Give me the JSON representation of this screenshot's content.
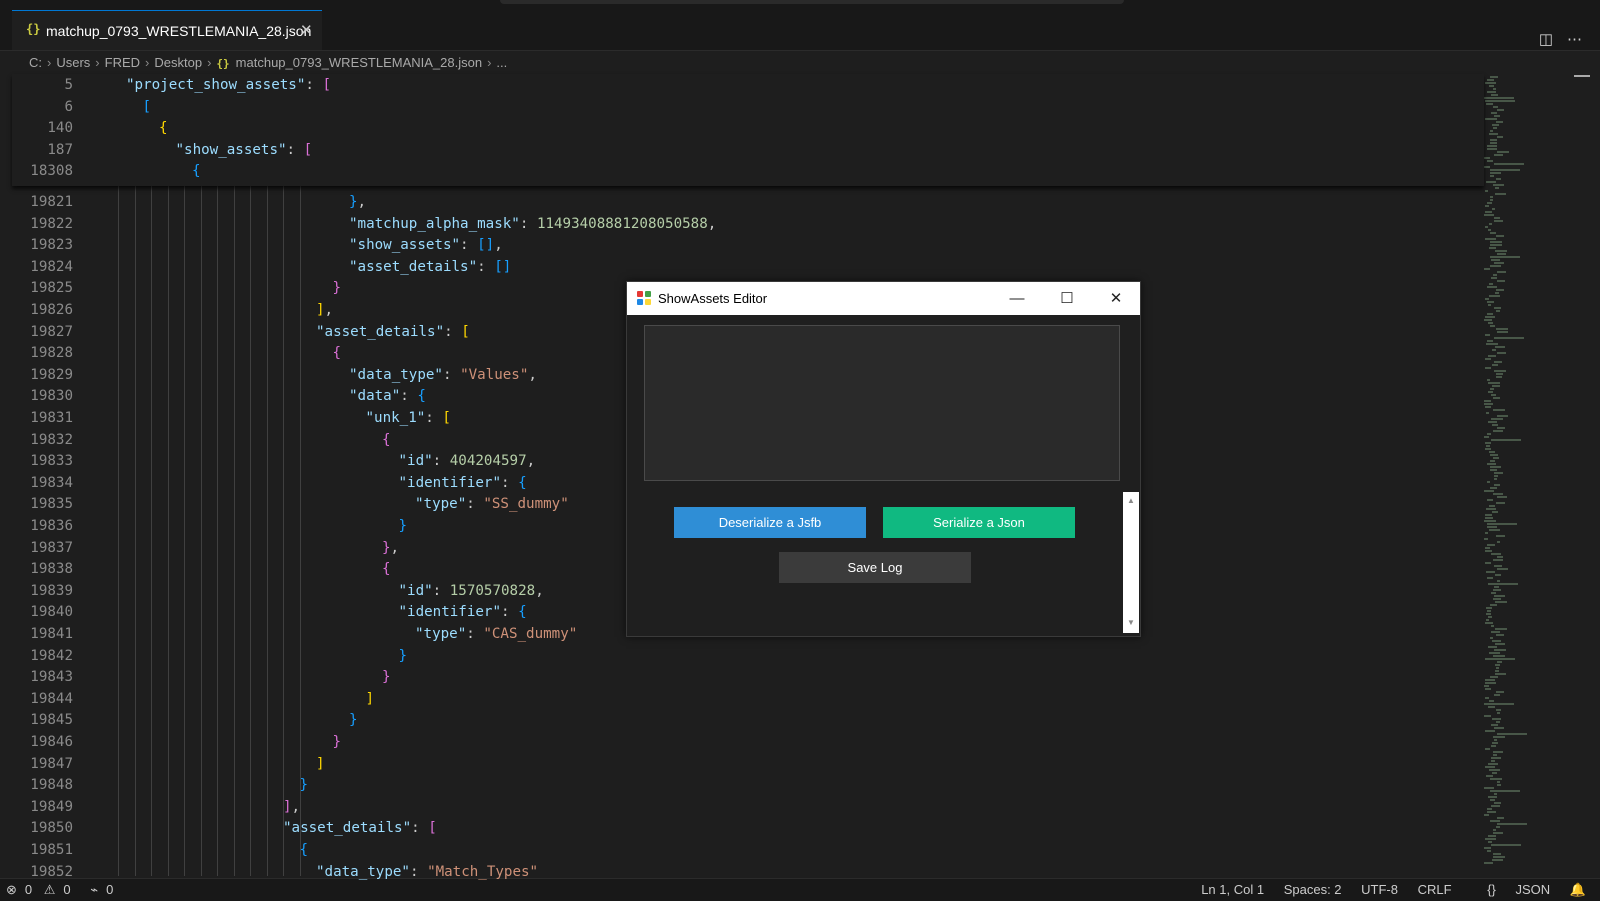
{
  "tab": {
    "label": "matchup_0793_WRESTLEMANIA_28.json",
    "icon": "{}"
  },
  "breadcrumb": [
    "C:",
    "Users",
    "FRED",
    "Desktop",
    "matchup_0793_WRESTLEMANIA_28.json",
    "..."
  ],
  "sticky_lines": [
    {
      "no": "5",
      "indent": 1,
      "parts": [
        [
          "k",
          "\"project_show_assets\""
        ],
        [
          "p",
          ": "
        ],
        [
          "b2",
          "["
        ]
      ]
    },
    {
      "no": "6",
      "indent": 2,
      "parts": [
        [
          "b3",
          "["
        ]
      ]
    },
    {
      "no": "140",
      "indent": 3,
      "parts": [
        [
          "b1",
          "{"
        ]
      ]
    },
    {
      "no": "187",
      "indent": 4,
      "parts": [
        [
          "k",
          "\"show_assets\""
        ],
        [
          "p",
          ": "
        ],
        [
          "b2",
          "["
        ]
      ]
    },
    {
      "no": "18308",
      "indent": 5,
      "parts": [
        [
          "b3",
          "{"
        ]
      ]
    }
  ],
  "lines": [
    {
      "no": "19821",
      "indent": 14,
      "parts": [
        [
          "b3",
          "}"
        ],
        [
          "p",
          ","
        ]
      ]
    },
    {
      "no": "19822",
      "indent": 14,
      "parts": [
        [
          "k",
          "\"matchup_alpha_mask\""
        ],
        [
          "p",
          ": "
        ],
        [
          "n",
          "11493408881208050588"
        ],
        [
          "p",
          ","
        ]
      ]
    },
    {
      "no": "19823",
      "indent": 14,
      "parts": [
        [
          "k",
          "\"show_assets\""
        ],
        [
          "p",
          ": "
        ],
        [
          "b3",
          "[]"
        ],
        [
          "p",
          ","
        ]
      ]
    },
    {
      "no": "19824",
      "indent": 14,
      "parts": [
        [
          "k",
          "\"asset_details\""
        ],
        [
          "p",
          ": "
        ],
        [
          "b3",
          "[]"
        ]
      ]
    },
    {
      "no": "19825",
      "indent": 13,
      "parts": [
        [
          "b2",
          "}"
        ]
      ]
    },
    {
      "no": "19826",
      "indent": 12,
      "parts": [
        [
          "b1",
          "]"
        ],
        [
          "p",
          ","
        ]
      ]
    },
    {
      "no": "19827",
      "indent": 12,
      "parts": [
        [
          "k",
          "\"asset_details\""
        ],
        [
          "p",
          ": "
        ],
        [
          "b1",
          "["
        ]
      ]
    },
    {
      "no": "19828",
      "indent": 13,
      "parts": [
        [
          "b2",
          "{"
        ]
      ]
    },
    {
      "no": "19829",
      "indent": 14,
      "parts": [
        [
          "k",
          "\"data_type\""
        ],
        [
          "p",
          ": "
        ],
        [
          "s",
          "\"Values\""
        ],
        [
          "p",
          ","
        ]
      ]
    },
    {
      "no": "19830",
      "indent": 14,
      "parts": [
        [
          "k",
          "\"data\""
        ],
        [
          "p",
          ": "
        ],
        [
          "b3",
          "{"
        ]
      ]
    },
    {
      "no": "19831",
      "indent": 15,
      "parts": [
        [
          "k",
          "\"unk_1\""
        ],
        [
          "p",
          ": "
        ],
        [
          "b1",
          "["
        ]
      ]
    },
    {
      "no": "19832",
      "indent": 16,
      "parts": [
        [
          "b2",
          "{"
        ]
      ]
    },
    {
      "no": "19833",
      "indent": 17,
      "parts": [
        [
          "k",
          "\"id\""
        ],
        [
          "p",
          ": "
        ],
        [
          "n",
          "404204597"
        ],
        [
          "p",
          ","
        ]
      ]
    },
    {
      "no": "19834",
      "indent": 17,
      "parts": [
        [
          "k",
          "\"identifier\""
        ],
        [
          "p",
          ": "
        ],
        [
          "b3",
          "{"
        ]
      ]
    },
    {
      "no": "19835",
      "indent": 18,
      "parts": [
        [
          "k",
          "\"type\""
        ],
        [
          "p",
          ": "
        ],
        [
          "s",
          "\"SS_dummy\""
        ]
      ]
    },
    {
      "no": "19836",
      "indent": 17,
      "parts": [
        [
          "b3",
          "}"
        ]
      ]
    },
    {
      "no": "19837",
      "indent": 16,
      "parts": [
        [
          "b2",
          "}"
        ],
        [
          "p",
          ","
        ]
      ]
    },
    {
      "no": "19838",
      "indent": 16,
      "parts": [
        [
          "b2",
          "{"
        ]
      ]
    },
    {
      "no": "19839",
      "indent": 17,
      "parts": [
        [
          "k",
          "\"id\""
        ],
        [
          "p",
          ": "
        ],
        [
          "n",
          "1570570828"
        ],
        [
          "p",
          ","
        ]
      ]
    },
    {
      "no": "19840",
      "indent": 17,
      "parts": [
        [
          "k",
          "\"identifier\""
        ],
        [
          "p",
          ": "
        ],
        [
          "b3",
          "{"
        ]
      ]
    },
    {
      "no": "19841",
      "indent": 18,
      "parts": [
        [
          "k",
          "\"type\""
        ],
        [
          "p",
          ": "
        ],
        [
          "s",
          "\"CAS_dummy\""
        ]
      ]
    },
    {
      "no": "19842",
      "indent": 17,
      "parts": [
        [
          "b3",
          "}"
        ]
      ]
    },
    {
      "no": "19843",
      "indent": 16,
      "parts": [
        [
          "b2",
          "}"
        ]
      ]
    },
    {
      "no": "19844",
      "indent": 15,
      "parts": [
        [
          "b1",
          "]"
        ]
      ]
    },
    {
      "no": "19845",
      "indent": 14,
      "parts": [
        [
          "b3",
          "}"
        ]
      ]
    },
    {
      "no": "19846",
      "indent": 13,
      "parts": [
        [
          "b2",
          "}"
        ]
      ]
    },
    {
      "no": "19847",
      "indent": 12,
      "parts": [
        [
          "b1",
          "]"
        ]
      ]
    },
    {
      "no": "19848",
      "indent": 11,
      "parts": [
        [
          "b3",
          "}"
        ]
      ]
    },
    {
      "no": "19849",
      "indent": 10,
      "parts": [
        [
          "b2",
          "]"
        ],
        [
          "p",
          ","
        ]
      ]
    },
    {
      "no": "19850",
      "indent": 10,
      "parts": [
        [
          "k",
          "\"asset_details\""
        ],
        [
          "p",
          ": "
        ],
        [
          "b2",
          "["
        ]
      ]
    },
    {
      "no": "19851",
      "indent": 11,
      "parts": [
        [
          "b3",
          "{"
        ]
      ]
    },
    {
      "no": "19852",
      "indent": 12,
      "parts": [
        [
          "k",
          "\"data_type\""
        ],
        [
          "p",
          ": "
        ],
        [
          "s",
          "\"Match_Types\""
        ]
      ]
    }
  ],
  "dialog": {
    "title": "ShowAssets Editor",
    "log_text": "",
    "buttons": {
      "deserialize": "Deserialize a Jsfb",
      "serialize": "Serialize a Json",
      "save_log": "Save Log"
    },
    "colors": {
      "deserialize": "#2f8ed6",
      "serialize": "#10b981",
      "save_log": "#3b3b3b"
    }
  },
  "status": {
    "errors": "0",
    "warnings": "0",
    "ports": "0",
    "position": "Ln 1, Col 1",
    "spaces": "Spaces: 2",
    "encoding": "UTF-8",
    "eol": "CRLF",
    "language": "JSON"
  },
  "colors": {
    "accent": "#0078d4",
    "key": "#9cdcfe",
    "string": "#ce9178",
    "number": "#b5cea8"
  }
}
